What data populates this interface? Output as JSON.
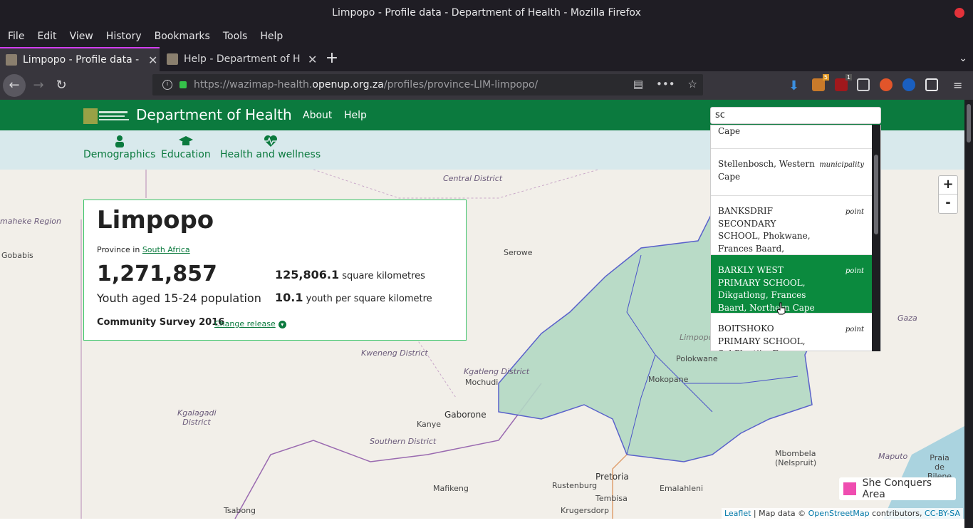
{
  "window": {
    "title": "Limpopo - Profile data - Department of Health - Mozilla Firefox"
  },
  "menu": [
    "File",
    "Edit",
    "View",
    "History",
    "Bookmarks",
    "Tools",
    "Help"
  ],
  "tabs": [
    {
      "label": "Limpopo - Profile data - Department of Health",
      "active": true
    },
    {
      "label": "Help - Department of Health",
      "active": false
    }
  ],
  "url": {
    "prefix": "https://wazimap-health.",
    "domain": "openup.org.za",
    "path": "/profiles/province-LIM-limpopo/"
  },
  "extensions": {
    "badge_a": "5",
    "badge_b": "1"
  },
  "site": {
    "name": "Department of Health",
    "nav": [
      "About",
      "Help"
    ],
    "search_value": "sc"
  },
  "subnav": [
    {
      "label": "Demographics",
      "icon": "person-icon"
    },
    {
      "label": "Education",
      "icon": "graduation-cap-icon"
    },
    {
      "label": "Health and wellness",
      "icon": "heartbeat-icon"
    }
  ],
  "profile": {
    "name": "Limpopo",
    "type_prefix": "Province in",
    "parent": "South Africa",
    "headline_value": "1,271,857",
    "headline_label": "Youth aged 15-24 population",
    "area_value": "125,806.1",
    "area_unit": "square kilometres",
    "density_value": "10.1",
    "density_unit": "youth per square kilometre",
    "release": "Community Survey 2016",
    "change_release": "Change release"
  },
  "dropdown": [
    {
      "name": "Cape",
      "type": ""
    },
    {
      "name": "Stellenbosch, Western Cape",
      "type": "municipality"
    },
    {
      "name": "BANKSDRIF SECONDARY SCHOOL, Phokwane, Frances Baard, Northern Cape",
      "type": "point"
    },
    {
      "name": "BARKLY WEST PRIMARY SCHOOL, Dikgatlong, Frances Baard, Northern Cape",
      "type": "point",
      "highlighted": true
    },
    {
      "name": "BOITSHOKO PRIMARY SCHOOL, Sol Plaatjie, Frances Baard, Northern Cape",
      "type": "point"
    }
  ],
  "map": {
    "labels": {
      "central_district": "Central District",
      "gobabis": "Gobabis",
      "maheke": "maheke Region",
      "serowe": "Serowe",
      "kweneng": "Kweneng District",
      "kgatleng": "Kgatleng District",
      "mochudi": "Mochudi",
      "gaborone": "Gaborone",
      "kanye": "Kanye",
      "kgalagadi": "Kgalagadi District",
      "southern": "Southern District",
      "limpopo": "Limpopo",
      "polokwane": "Polokwane",
      "mokopane": "Mokopane",
      "gaza": "Gaza",
      "pretoria": "Pretoria",
      "rustenburg": "Rustenburg",
      "tembisa": "Tembisa",
      "mafikeng": "Mafikeng",
      "tsabong": "Tsabong",
      "mbombela": "Mbombela (Nelspruit)",
      "maputo": "Maputo",
      "praia": "Praia de Bilene",
      "emalahleni": "Emalahleni",
      "krugersdorp": "Krugersdorp"
    },
    "zoom_in": "+",
    "zoom_out": "-",
    "legend": "She Conquers Area",
    "legend_color": "#ef4db0",
    "region_color": "#b3d9c4",
    "attribution": {
      "leaflet": "Leaflet",
      "mid": " | Map data © ",
      "osm": "OpenStreetMap",
      "contrib": " contributors, ",
      "license": "CC-BY-SA"
    }
  },
  "colors": {
    "brand_green": "#0b7a3e",
    "subnav_bg": "#d8e9ec",
    "firefox_dark": "#1f1d24"
  }
}
